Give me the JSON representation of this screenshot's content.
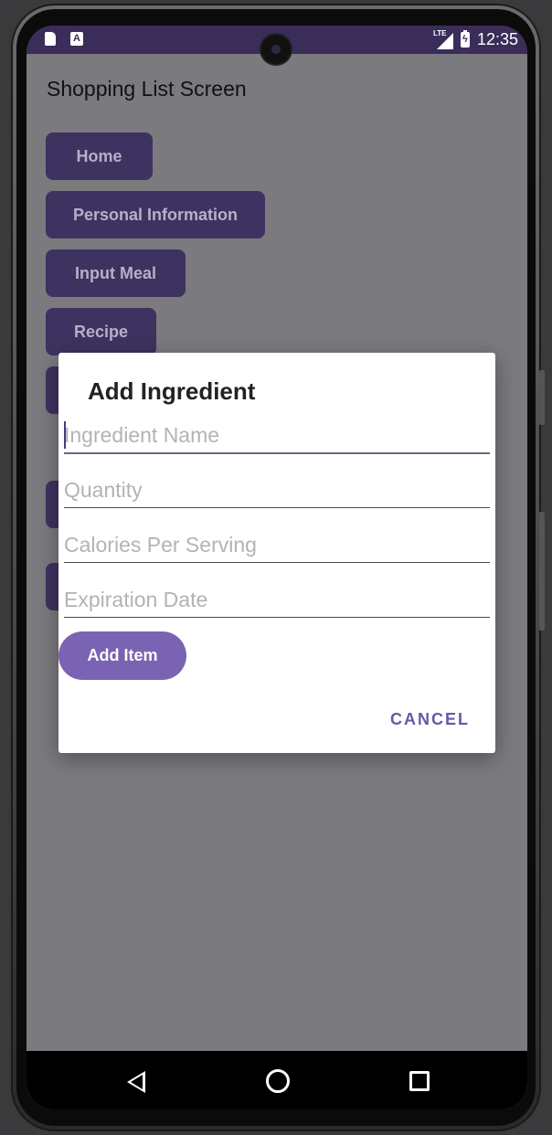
{
  "status_bar": {
    "time": "12:35",
    "network": "LTE",
    "icons": [
      "sd-card-icon",
      "a-notification-icon",
      "signal-icon",
      "battery-charging-icon"
    ]
  },
  "screen": {
    "title": "Shopping List Screen",
    "nav_buttons": [
      {
        "label": "Home"
      },
      {
        "label": "Personal Information"
      },
      {
        "label": "Input Meal"
      },
      {
        "label": "Recipe"
      }
    ]
  },
  "dialog": {
    "title": "Add Ingredient",
    "fields": [
      {
        "placeholder": "Ingredient Name",
        "value": ""
      },
      {
        "placeholder": "Quantity",
        "value": ""
      },
      {
        "placeholder": "Calories Per Serving",
        "value": ""
      },
      {
        "placeholder": "Expiration Date",
        "value": ""
      }
    ],
    "add_button": "Add Item",
    "cancel_button": "CANCEL"
  },
  "colors": {
    "status_bar": "#3a2d59",
    "nav_button": "#3e3260",
    "accent": "#7a63b3",
    "cancel_text": "#6a56a6",
    "scrim_background": "#7b7a7e"
  }
}
